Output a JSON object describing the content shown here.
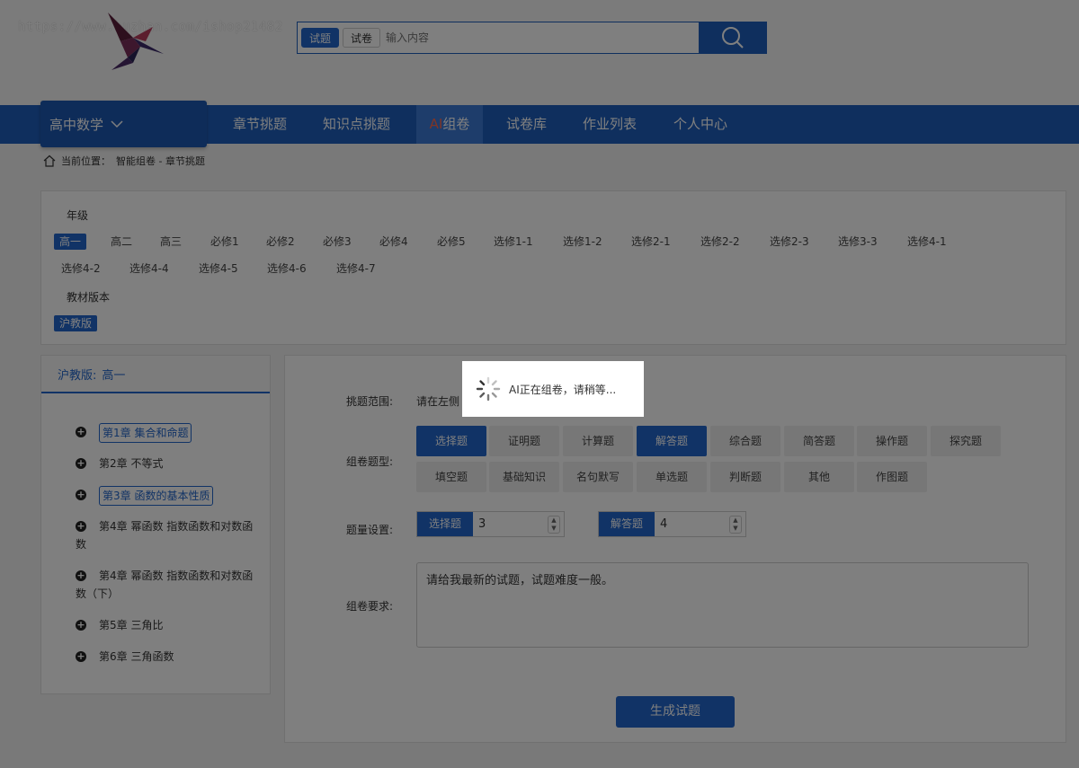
{
  "header": {
    "watermark": "https://www.huzhan.com/ishop21482",
    "search_tabs": [
      "试题",
      "试卷"
    ],
    "search_placeholder": "输入内容"
  },
  "nav": {
    "subject": "高中数学",
    "items": [
      "章节挑题",
      "知识点挑题",
      "AI组卷",
      "试卷库",
      "作业列表",
      "个人中心"
    ],
    "ai_prefix": "AI",
    "ai_suffix": "组卷"
  },
  "breadcrumb": {
    "prefix": "当前位置：",
    "path": "智能组卷 - 章节挑题"
  },
  "filter": {
    "grade_label": "年级",
    "grades_row1": [
      "高一",
      "高二",
      "高三",
      "必修1",
      "必修2",
      "必修3",
      "必修4",
      "必修5",
      "选修1-1",
      "选修1-2",
      "选修2-1",
      "选修2-2",
      "选修2-3",
      "选修3-3",
      "选修4-1"
    ],
    "grades_row2": [
      "选修4-2",
      "选修4-4",
      "选修4-5",
      "选修4-6",
      "选修4-7"
    ],
    "edition_label": "教材版本",
    "edition": "沪教版"
  },
  "left_panel": {
    "edition": "沪教版:",
    "grade": "高一",
    "chapters": [
      "第1章 集合和命题",
      "第2章 不等式",
      "第3章 函数的基本性质",
      "第4章 幂函数 指数函数和对数函数",
      "第4章 幂函数 指数函数和对数函数（下）",
      "第5章 三角比",
      "第6章 三角函数"
    ]
  },
  "right_panel": {
    "scope_label": "挑题范围:",
    "scope_text": "请在左侧",
    "type_label": "组卷题型:",
    "types_row1": [
      "选择题",
      "证明题",
      "计算题",
      "解答题",
      "综合题",
      "简答题",
      "操作题",
      "探究题"
    ],
    "types_row2": [
      "填空题",
      "基础知识",
      "名句默写",
      "单选题",
      "判断题",
      "其他",
      "作图题"
    ],
    "qty_label": "题量设置:",
    "qty": [
      {
        "name": "选择题",
        "value": "3"
      },
      {
        "name": "解答题",
        "value": "4"
      }
    ],
    "req_label": "组卷要求:",
    "req_text": "请给我最新的试题，试题难度一般。",
    "generate": "生成试题"
  },
  "loading": {
    "text": "AI正在组卷，请稍等..."
  },
  "colors": {
    "primary": "#2266cc",
    "nav": "#1f5fbd",
    "ai_accent": "#ff6a4d"
  }
}
